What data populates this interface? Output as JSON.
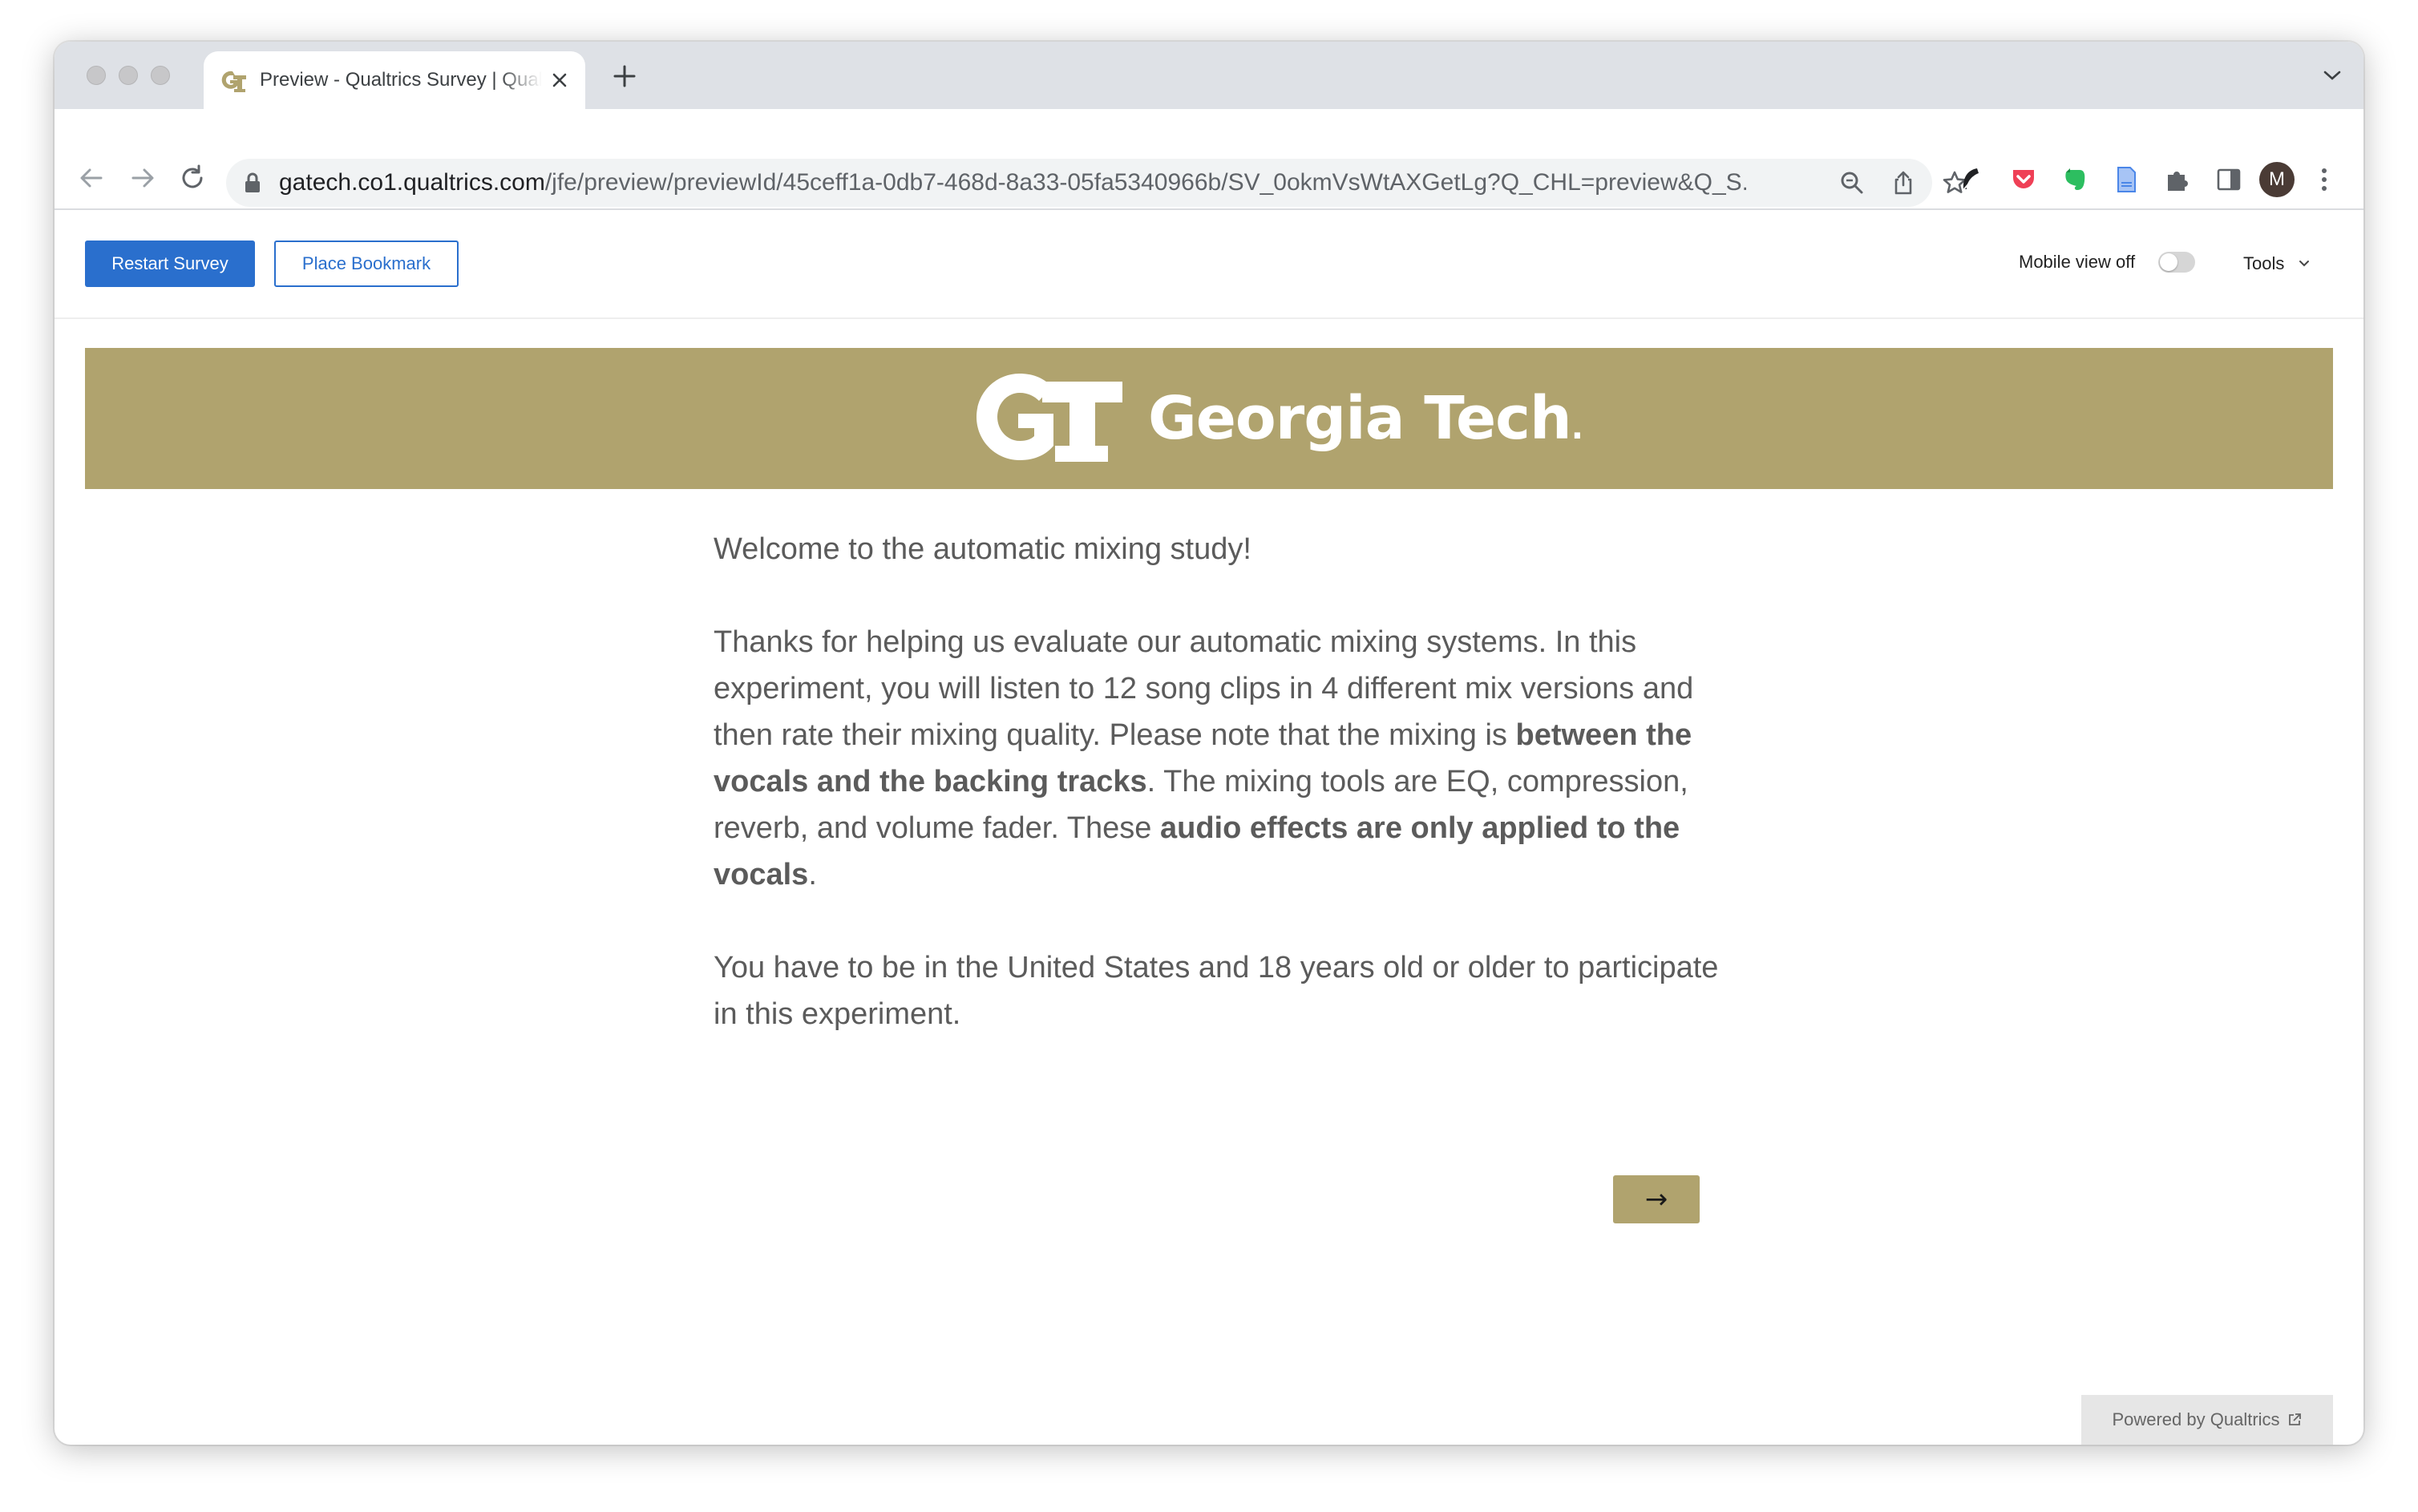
{
  "browser": {
    "tab": {
      "title": "Preview - Qualtrics Survey | Qualtrics Experience Management"
    },
    "url": {
      "host": "gatech.co1.qualtrics.com",
      "path": "/jfe/preview/previewId/45ceff1a-0db7-468d-8a33-05fa5340966b/SV_0okmVsWtAXGetLg?Q_CHL=preview&Q_S..."
    },
    "profile_initial": "M"
  },
  "preview_bar": {
    "restart_label": "Restart Survey",
    "bookmark_label": "Place Bookmark",
    "mobile_view_label": "Mobile view off",
    "mobile_view_on": false,
    "tools_label": "Tools"
  },
  "banner": {
    "brand_text": "Georgia Tech",
    "brand_dot": ".",
    "color": "#b0a36e"
  },
  "survey": {
    "welcome": "Welcome to the automatic mixing study!",
    "intro": {
      "part1": "Thanks for helping us evaluate our automatic mixing systems. In this experiment, you will listen to 12 song clips in 4 different mix versions and then rate their mixing quality. Please note that the mixing is ",
      "bold1": "between the vocals and the backing tracks",
      "part2": ". The mixing tools are EQ, compression, reverb, and volume fader. These ",
      "bold2": "audio effects are only applied to the vocals",
      "part3": "."
    },
    "eligibility": "You have to be in the United States and 18 years old or older to participate in this experiment.",
    "next_label": "→"
  },
  "footer": {
    "powered_label": "Powered by Qualtrics"
  },
  "colors": {
    "primary": "#2a6fcd",
    "gold": "#b0a36e"
  }
}
